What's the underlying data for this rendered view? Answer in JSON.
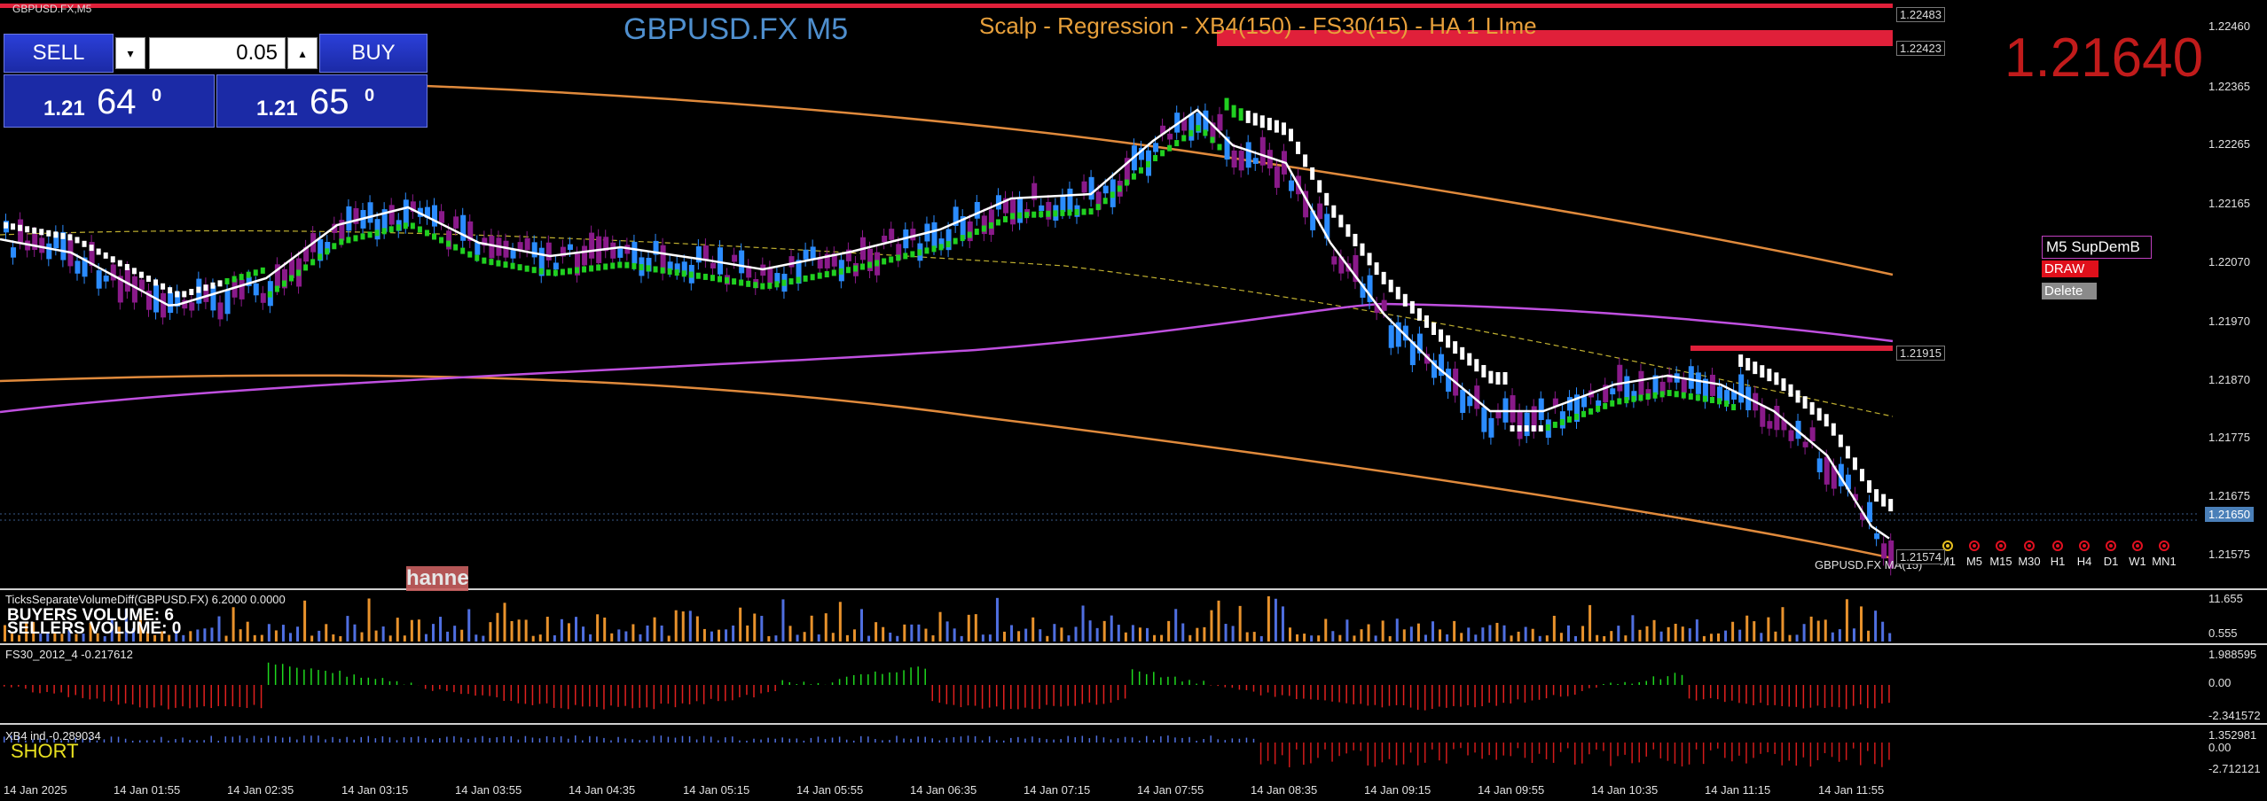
{
  "symbol": "GBPUSD.FX,M5",
  "title": "GBPUSD.FX M5",
  "strategy": "Scalp - Regression - XB4(150) - FS30(15) - HA  1 LIme",
  "big_bid": "1.21640",
  "colors": {
    "bull": "#2b8cff",
    "bear": "#8a1a8a",
    "up_dot": "#20d020",
    "down_dot": "#ffffff",
    "reg_upper": "#e08a3c",
    "reg_mid": "#c0b030",
    "ma_purple": "#c050e0",
    "ma_white": "#ffffff",
    "resistance": "#e0203a"
  },
  "trade_panel": {
    "sell_label": "SELL",
    "buy_label": "BUY",
    "lot": "0.05",
    "down_icon": "triangle-down-icon",
    "up_icon": "triangle-up-icon",
    "sell_price": {
      "prefix": "1.21",
      "big": "64",
      "sup": "0"
    },
    "buy_price": {
      "prefix": "1.21",
      "big": "65",
      "sup": "0"
    }
  },
  "price_axis": [
    "1.22460",
    "1.22365",
    "1.22265",
    "1.22165",
    "1.22070",
    "1.21970",
    "1.21870",
    "1.21775",
    "1.21675",
    "1.21575"
  ],
  "price_tags": {
    "top": "1.22483",
    "r1": "1.22423",
    "r2": "1.21915",
    "current": "1.21650",
    "low": "1.21574"
  },
  "time_axis": [
    "14 Jan 2025",
    "14 Jan 01:55",
    "14 Jan 02:35",
    "14 Jan 03:15",
    "14 Jan 03:55",
    "14 Jan 04:35",
    "14 Jan 05:15",
    "14 Jan 05:55",
    "14 Jan 06:35",
    "14 Jan 07:15",
    "14 Jan 07:55",
    "14 Jan 08:35",
    "14 Jan 09:15",
    "14 Jan 09:55",
    "14 Jan 10:35",
    "14 Jan 11:15",
    "14 Jan 11:55"
  ],
  "supdem": {
    "title": "M5 SupDemB",
    "draw": "DRAW",
    "delete": "Delete"
  },
  "timeframes": [
    "M1",
    "M5",
    "M15",
    "M30",
    "H1",
    "H4",
    "D1",
    "W1",
    "MN1"
  ],
  "ma_label": "GBPUSD.FX MA(15)",
  "channel_label": "hanne",
  "volume": {
    "label": "TicksSeparateVolumeDiff(GBPUSD.FX) 6.2000 0.0000",
    "buyers": "BUYERS VOLUME: 6",
    "sellers": "SELLERS VOLUME: 0",
    "axis": [
      "11.655",
      "0.555"
    ]
  },
  "fs30": {
    "label": "FS30_2012_4 -0.217612",
    "axis": [
      "1.988595",
      "0.00",
      "-2.341572"
    ]
  },
  "xb4": {
    "label": "XB4 ind -0.289034",
    "axis": [
      "1.352981",
      "0.00",
      "-2.712121"
    ],
    "signal": "SHORT"
  }
}
